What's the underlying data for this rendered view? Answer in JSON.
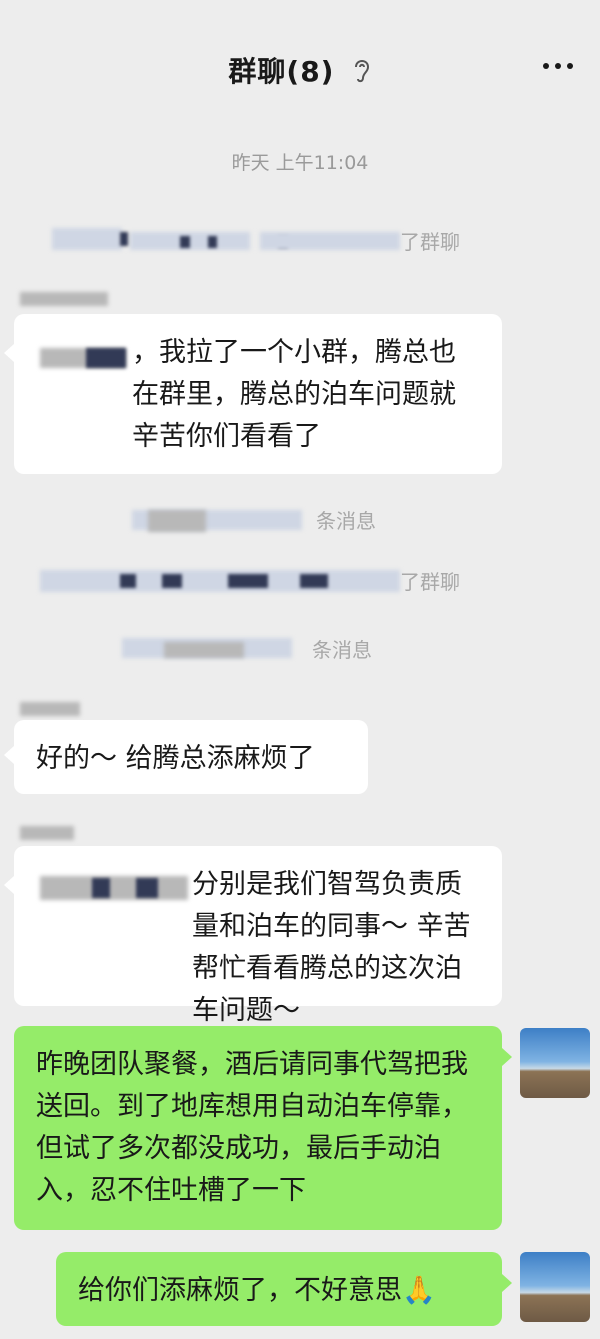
{
  "header": {
    "title": "群聊(8)"
  },
  "timestamp": "昨天 上午11:04",
  "system_messages": {
    "joined_1": "了群聊",
    "recalled_1": "条消息",
    "joined_2": "了群聊",
    "recalled_2": "条消息"
  },
  "messages": [
    {
      "text": "，我拉了一个小群，腾总也在群里，腾总的泊车问题就辛苦你们看看了"
    },
    {
      "text": "好的～ 给腾总添麻烦了"
    },
    {
      "text": "分别是我们智驾负责质量和泊车的同事～ 辛苦帮忙看看腾总的这次泊车问题～"
    },
    {
      "text": "昨晚团队聚餐，酒后请同事代驾把我送回。到了地库想用自动泊车停靠，但试了多次都没成功，最后手动泊入，忍不住吐槽了一下"
    },
    {
      "text": "给你们添麻烦了，不好意思",
      "emoji": "🙏"
    }
  ],
  "colors": {
    "background": "#ededed",
    "incoming": "#ffffff",
    "outgoing": "#95ec69"
  }
}
